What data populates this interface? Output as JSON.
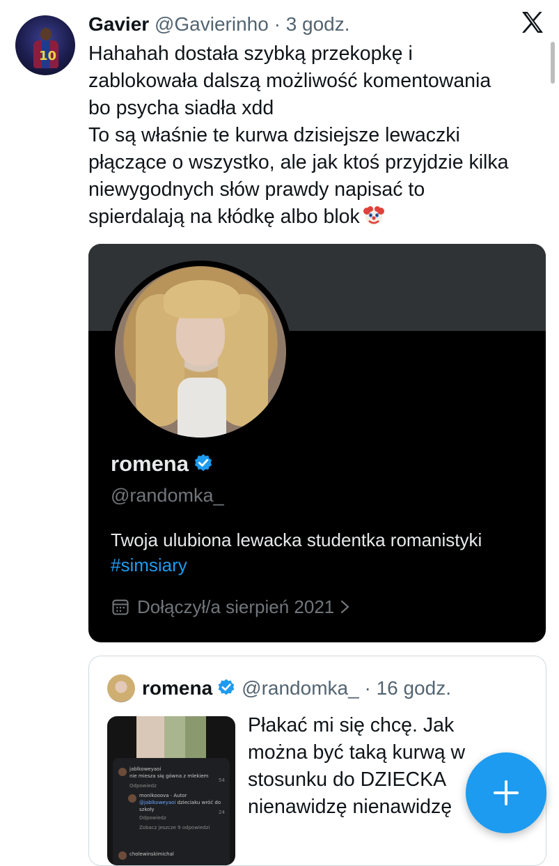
{
  "tweet": {
    "author_name": "Gavier",
    "author_handle": "@Gavierinho",
    "separator": " · ",
    "time": "3 godz.",
    "text": "Hahahah dostała szybką przekopkę i\nzablokowała dalszą możliwość komentowania\nbo psycha siadła xdd\nTo są właśnie te kurwa dzisiejsze lewaczki\npłączące o wszystko, ale jak ktoś przyjdzie kilka\nniewygodnych słów prawdy napisać to\nspierdalają na kłódkę albo blok",
    "emoji_icon": "clown-face-icon",
    "avatar_number": "10"
  },
  "profile_card": {
    "name": "romena",
    "handle": "@randomka_",
    "bio": "Twoja ulubiona lewacka studentka romanistyki",
    "hashtag": "#simsiary",
    "joined": "Dołączył/a sierpień 2021",
    "verified_color": "#1d9bf0"
  },
  "quoted_tweet": {
    "name": "romena",
    "handle": "@randomka_",
    "separator": " · ",
    "time": "16 godz.",
    "text": "Płakać mi się chcę. Jak\nmożna być taką kurwą w\nstosunku do DZIECKA\nnienawidzę nienawidzę",
    "thumbnail_comments": {
      "c1_user": "jablkoweyaoi",
      "c1_text": "nie miesza się gówna z mlekiem",
      "c1_reply": "Odpowiedz",
      "c1_count": "54",
      "c2_user": "monikooova",
      "c2_tag": "Autor",
      "c2_text": "dzieciaku wróć do",
      "c2_mention": "@jablkoweyaoi",
      "c2_text2": "szkoły",
      "c2_reply": "Odpowiedz",
      "c2_count": "24",
      "more": "Zobacz jeszcze 9 odpowiedzi",
      "c3_user": "cholewinskimichal"
    }
  },
  "fab": {
    "label": "+",
    "color": "#1d9bf0"
  },
  "colors": {
    "text": "#0f1419",
    "secondary": "#536471",
    "card_bg": "#000000"
  }
}
